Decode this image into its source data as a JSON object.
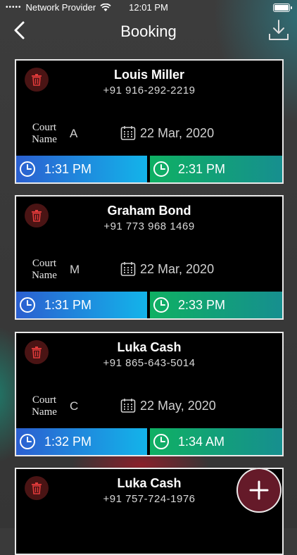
{
  "status_bar": {
    "carrier": "Network Provider",
    "time": "12:01 PM"
  },
  "header": {
    "title": "Booking"
  },
  "court_label_line1": "Court",
  "court_label_line2": "Name",
  "bookings": [
    {
      "name": "Louis Miller",
      "phone": "+91 916-292-2219",
      "court": "A",
      "date": "22 Mar, 2020",
      "start": "1:31 PM",
      "end": "2:31 PM"
    },
    {
      "name": "Graham Bond",
      "phone": "+91 773 968 1469",
      "court": "M",
      "date": "22 Mar, 2020",
      "start": "1:31 PM",
      "end": "2:33 PM"
    },
    {
      "name": "Luka Cash",
      "phone": "+91 865-643-5014",
      "court": "C",
      "date": "22 May, 2020",
      "start": "1:32 PM",
      "end": "1:34 AM"
    },
    {
      "name": "Luka Cash",
      "phone": "+91 757-724-1976"
    }
  ],
  "colors": {
    "start_gradient": [
      "#2b5fd0",
      "#13b4ea"
    ],
    "end_gradient": [
      "#0fb063",
      "#168f8f"
    ],
    "fab": "#651a29",
    "trash_icon": "#e23b3b"
  }
}
